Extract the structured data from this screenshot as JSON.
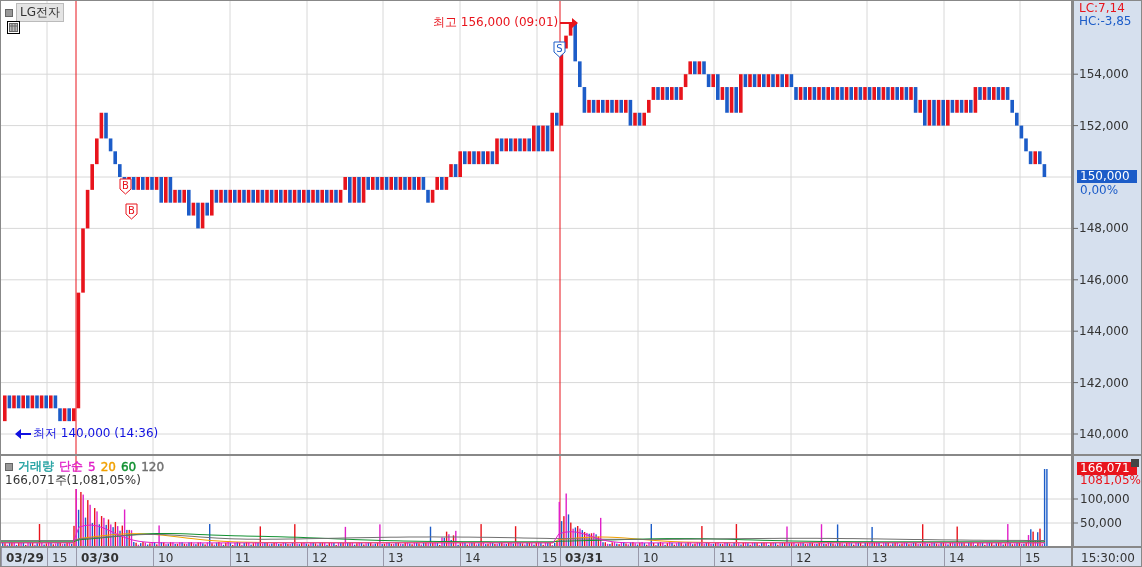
{
  "symbol": {
    "label": "LG전자"
  },
  "price_scale": {
    "indicators": [
      {
        "text": "LC:7,14",
        "kind": "low"
      },
      {
        "text": "HC:-3,85",
        "kind": "high"
      }
    ],
    "ticks": [
      "154,000",
      "152,000",
      "148,000",
      "146,000",
      "144,000",
      "142,000",
      "140,000"
    ],
    "current": {
      "price": "150,000",
      "change": "0,00%"
    }
  },
  "annotations": [
    {
      "kind": "high",
      "text": "최고 156,000 (09:01)"
    },
    {
      "kind": "low",
      "text": "최저 140,000 (14:36)"
    }
  ],
  "markers": [
    {
      "kind": "buy",
      "label": "B"
    },
    {
      "kind": "buy",
      "label": "B"
    },
    {
      "kind": "sell",
      "label": "S"
    }
  ],
  "volume": {
    "legend": [
      {
        "text": "거래량",
        "color": "#20a0a0"
      },
      {
        "text": "단순",
        "color": "#e020c8"
      },
      {
        "text": "5",
        "color": "#e020c8"
      },
      {
        "text": "20",
        "color": "#f0a000"
      },
      {
        "text": "60",
        "color": "#109030"
      },
      {
        "text": "120",
        "color": "#707070"
      }
    ],
    "summary": "166,071주(1,081,05%)",
    "current": {
      "value": "166,071",
      "change": "1081,05%"
    },
    "ticks": [
      "100,000",
      "50,000"
    ]
  },
  "time_axis": {
    "labels": [
      {
        "text": "03/29",
        "kind": "date"
      },
      {
        "text": "15",
        "kind": "hour"
      },
      {
        "text": "03/30",
        "kind": "date"
      },
      {
        "text": "10",
        "kind": "hour"
      },
      {
        "text": "11",
        "kind": "hour"
      },
      {
        "text": "12",
        "kind": "hour"
      },
      {
        "text": "13",
        "kind": "hour"
      },
      {
        "text": "14",
        "kind": "hour"
      },
      {
        "text": "15",
        "kind": "hour"
      },
      {
        "text": "03/31",
        "kind": "date"
      },
      {
        "text": "10",
        "kind": "hour"
      },
      {
        "text": "11",
        "kind": "hour"
      },
      {
        "text": "12",
        "kind": "hour"
      },
      {
        "text": "13",
        "kind": "hour"
      },
      {
        "text": "14",
        "kind": "hour"
      },
      {
        "text": "15",
        "kind": "hour"
      }
    ],
    "clock": "15:30:00"
  }
}
